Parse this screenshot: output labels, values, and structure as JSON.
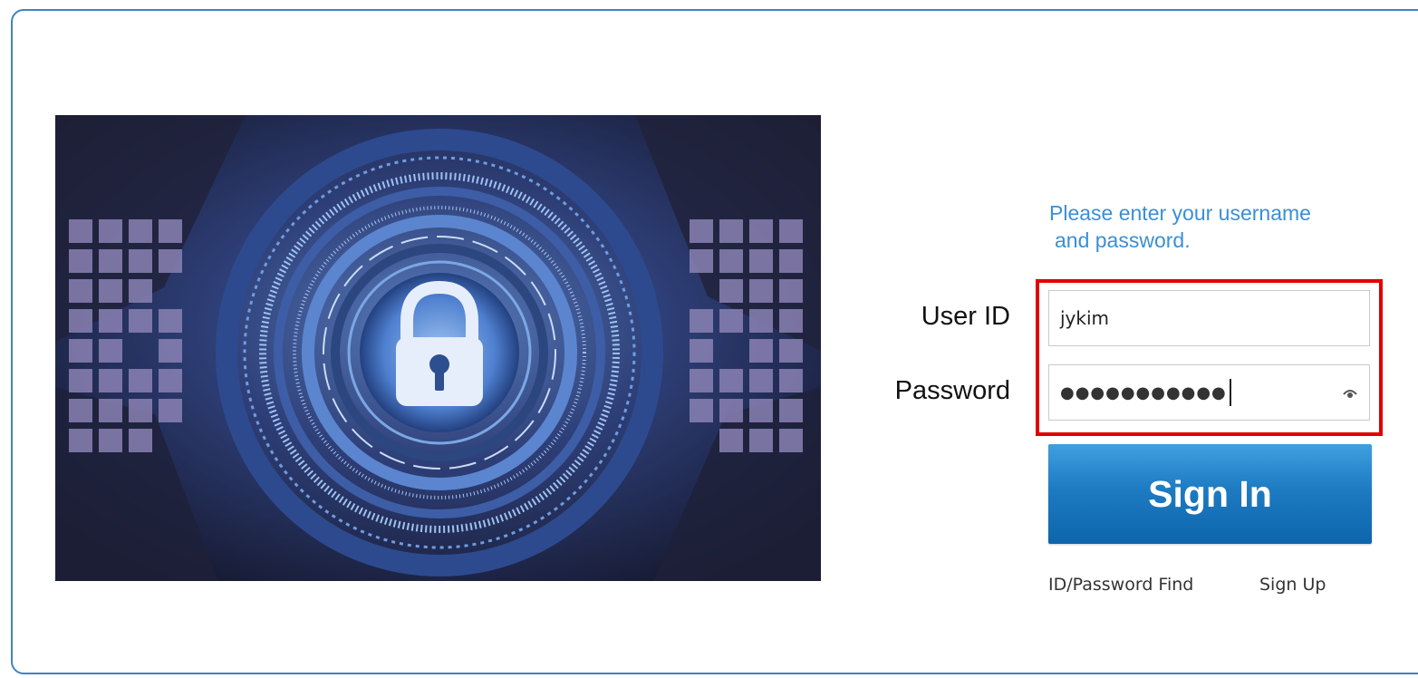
{
  "login": {
    "prompt_line1": "Please enter your username",
    "prompt_line2": "and password.",
    "userid_label": "User ID",
    "userid_value": "jykim",
    "password_label": "Password",
    "password_masked": "●●●●●●●●●●●",
    "signin_label": "Sign In",
    "find_link": "ID/Password Find",
    "signup_link": "Sign Up"
  },
  "icons": {
    "hero_image": "padlock-cyber-security-illustration",
    "password_toggle": "eye-icon"
  },
  "colors": {
    "accent": "#3a8fd6",
    "button": "#1d7bc2",
    "highlight": "#e10000",
    "frame_border": "#3f84c4"
  }
}
